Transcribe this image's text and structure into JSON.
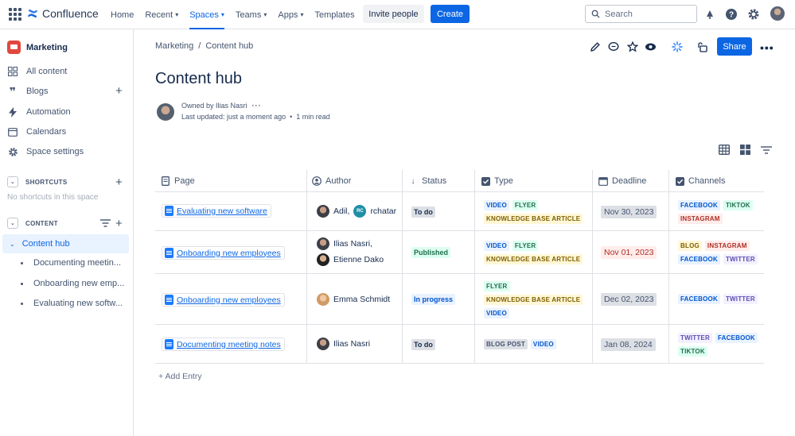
{
  "app": {
    "name": "Confluence"
  },
  "topnav": [
    {
      "label": "Home",
      "chevron": false
    },
    {
      "label": "Recent",
      "chevron": true
    },
    {
      "label": "Spaces",
      "chevron": true,
      "active": true
    },
    {
      "label": "Teams",
      "chevron": true
    },
    {
      "label": "Apps",
      "chevron": true
    },
    {
      "label": "Templates",
      "chevron": false
    }
  ],
  "header": {
    "invite_label": "Invite people",
    "create_label": "Create",
    "search_placeholder": "Search"
  },
  "sidebar": {
    "space_name": "Marketing",
    "items": [
      {
        "label": "All content",
        "icon": "grid-icon"
      },
      {
        "label": "Blogs",
        "icon": "quote-icon"
      },
      {
        "label": "Automation",
        "icon": "bolt-icon"
      },
      {
        "label": "Calendars",
        "icon": "calendar-icon"
      },
      {
        "label": "Space settings",
        "icon": "gear-icon"
      }
    ],
    "shortcuts_heading": "SHORTCUTS",
    "shortcuts_empty": "No shortcuts in this space",
    "content_heading": "CONTENT",
    "tree_active": "Content hub",
    "tree_children": [
      "Documenting meetin...",
      "Onboarding new emp...",
      "Evaluating new softw..."
    ]
  },
  "page": {
    "breadcrumb": [
      "Marketing",
      "Content hub"
    ],
    "title": "Content hub",
    "owner_text": "Owned by Ilias Nasri",
    "updated_text": "Last updated: just a moment ago",
    "read_time": "1 min read",
    "share_label": "Share"
  },
  "table": {
    "headers": [
      "Page",
      "Author",
      "Status",
      "Type",
      "Deadline",
      "Channels"
    ],
    "rows": [
      {
        "page": "Evaluating new software",
        "author_lines": [
          "Adil,",
          "rchatar"
        ],
        "status": "To do",
        "types": [
          "VIDEO",
          "FLYER",
          "KNOWLEDGE BASE ARTICLE"
        ],
        "deadline": "Nov 30, 2023",
        "channels": [
          "FACEBOOK",
          "TIKTOK",
          "INSTAGRAM"
        ]
      },
      {
        "page": "Onboarding new employees",
        "author_lines": [
          "Ilias Nasri,",
          "Etienne Dako"
        ],
        "status": "Published",
        "types": [
          "VIDEO",
          "FLYER",
          "KNOWLEDGE BASE ARTICLE"
        ],
        "deadline": "Nov 01, 2023",
        "channels": [
          "BLOG",
          "INSTAGRAM",
          "FACEBOOK",
          "TWITTER"
        ]
      },
      {
        "page": "Onboarding new employees",
        "author_lines": [
          "Emma Schmidt"
        ],
        "status": "In progress",
        "types": [
          "FLYER",
          "KNOWLEDGE BASE ARTICLE",
          "VIDEO"
        ],
        "deadline": "Dec 02, 2023",
        "channels": [
          "FACEBOOK",
          "TWITTER"
        ]
      },
      {
        "page": "Documenting meeting notes",
        "author_lines": [
          "Ilias Nasri"
        ],
        "status": "To do",
        "types": [
          "BLOG POST",
          "VIDEO"
        ],
        "deadline": "Jan 08, 2024",
        "channels": [
          "TWITTER",
          "FACEBOOK",
          "TIKTOK"
        ]
      }
    ],
    "avatar_initials": "RC",
    "add_entry": "+ Add Entry"
  },
  "colors": {
    "brand": "#0c66e4",
    "space_icon": "#e2483d"
  }
}
